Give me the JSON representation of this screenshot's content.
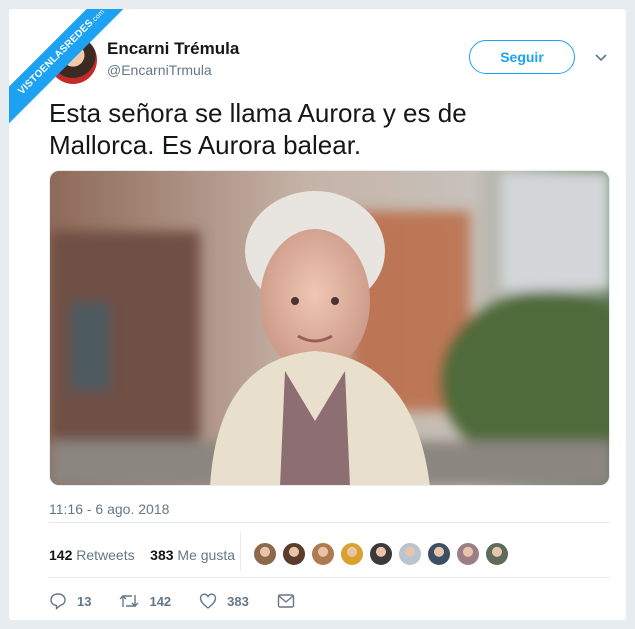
{
  "watermark": {
    "text": "VISTOENLASREDES",
    "suffix": ".com"
  },
  "author": {
    "name": "Encarni Trémula",
    "handle": "@EncarniTrmula"
  },
  "follow_label": "Seguir",
  "tweet": {
    "text_line1": "Esta señora se llama Aurora y es de",
    "text_line2": "Mallorca. Es Aurora balear.",
    "timestamp": "11:16 - 6 ago. 2018"
  },
  "stats": {
    "retweets_count": "142",
    "retweets_label": "Retweets",
    "likes_count": "383",
    "likes_label": "Me gusta"
  },
  "likers": [
    "#8a6a4a",
    "#5a3c2c",
    "#b07a50",
    "#d9a12e",
    "#3a3a3a",
    "#b8c4cf",
    "#3d4f66",
    "#9c7f86",
    "#5e6a5a"
  ],
  "actions": {
    "replies": "13",
    "retweets": "142",
    "likes": "383"
  },
  "colors": {
    "accent": "#1da1f2",
    "muted": "#657786"
  }
}
